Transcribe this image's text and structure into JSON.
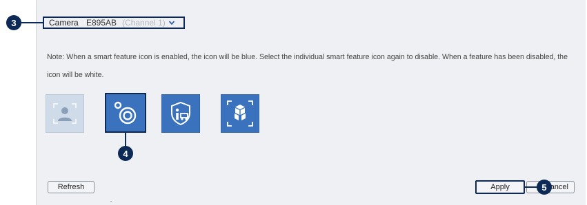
{
  "camera": {
    "label": "Camera",
    "value": "E895AB",
    "channel": "(Channel 1)"
  },
  "note": "Note: When a smart feature icon is enabled, the icon will be blue. Select the individual smart feature icon again to disable. When a feature has been disabled, the icon will be white.",
  "features": [
    {
      "icon": "face-detection-icon",
      "enabled": false
    },
    {
      "icon": "object-detection-icon",
      "enabled": true
    },
    {
      "icon": "person-vehicle-shield-icon",
      "enabled": true
    },
    {
      "icon": "missing-object-icon",
      "enabled": true
    }
  ],
  "buttons": {
    "refresh": "Refresh",
    "apply": "Apply",
    "cancel": "Cancel"
  },
  "markers": {
    "camera": "3",
    "feature": "4",
    "apply": "5"
  },
  "colors": {
    "accent_dark": "#0d2a57",
    "icon_enabled": "#3a72bd",
    "icon_disabled": "#cfdbe8",
    "panel_bg": "#eef0f3"
  }
}
